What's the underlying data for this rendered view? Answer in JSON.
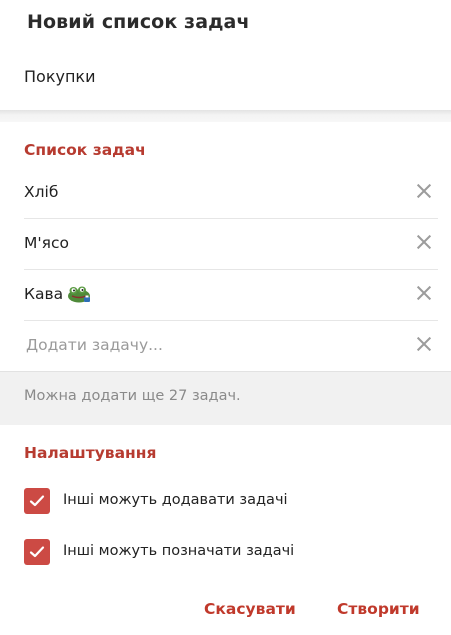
{
  "dialog": {
    "title": "Новий список задач",
    "list_name": "Покупки"
  },
  "tasks_section": {
    "title": "Список задач",
    "items": [
      {
        "text": "Хліб"
      },
      {
        "text": "М'ясо"
      },
      {
        "text": "Кава",
        "icon": "frog-sticker-icon"
      }
    ],
    "new_task_placeholder": "Додати задачу...",
    "hint": "Можна додати ще 27 задач."
  },
  "settings_section": {
    "title": "Налаштування",
    "options": [
      {
        "label": "Інші можуть додавати задачі",
        "checked": true
      },
      {
        "label": "Інші можуть позначати задачі",
        "checked": true
      }
    ]
  },
  "actions": {
    "cancel_label": "Скасувати",
    "create_label": "Створити"
  },
  "colors": {
    "accent": "#c0392b",
    "checkbox": "#cc4a44",
    "hint_background": "#f1f1f1"
  }
}
